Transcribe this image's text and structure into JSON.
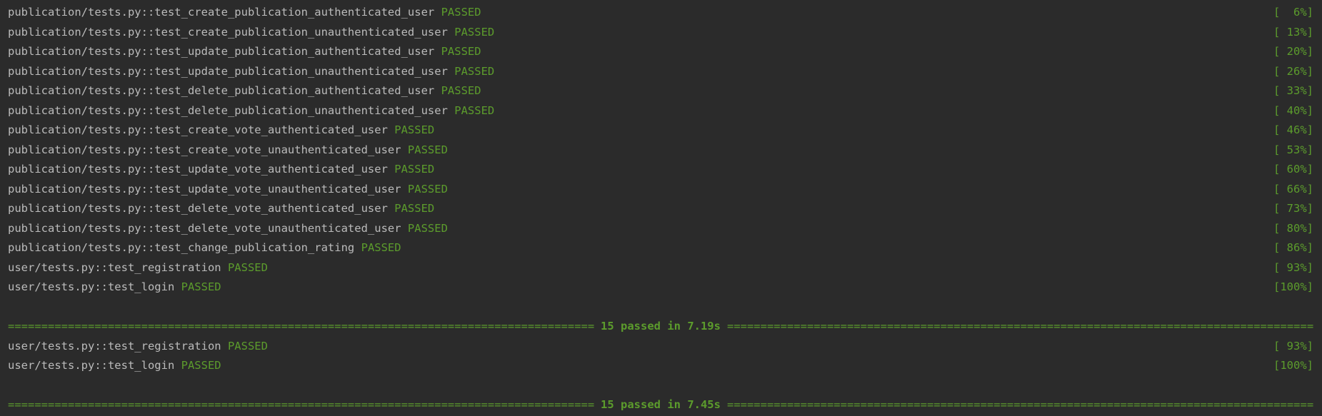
{
  "run1": {
    "lines": [
      {
        "test": "publication/tests.py::test_create_publication_authenticated_user",
        "status": "PASSED",
        "pct": "[  6%]"
      },
      {
        "test": "publication/tests.py::test_create_publication_unauthenticated_user",
        "status": "PASSED",
        "pct": "[ 13%]"
      },
      {
        "test": "publication/tests.py::test_update_publication_authenticated_user",
        "status": "PASSED",
        "pct": "[ 20%]"
      },
      {
        "test": "publication/tests.py::test_update_publication_unauthenticated_user",
        "status": "PASSED",
        "pct": "[ 26%]"
      },
      {
        "test": "publication/tests.py::test_delete_publication_authenticated_user",
        "status": "PASSED",
        "pct": "[ 33%]"
      },
      {
        "test": "publication/tests.py::test_delete_publication_unauthenticated_user",
        "status": "PASSED",
        "pct": "[ 40%]"
      },
      {
        "test": "publication/tests.py::test_create_vote_authenticated_user",
        "status": "PASSED",
        "pct": "[ 46%]"
      },
      {
        "test": "publication/tests.py::test_create_vote_unauthenticated_user",
        "status": "PASSED",
        "pct": "[ 53%]"
      },
      {
        "test": "publication/tests.py::test_update_vote_authenticated_user",
        "status": "PASSED",
        "pct": "[ 60%]"
      },
      {
        "test": "publication/tests.py::test_update_vote_unauthenticated_user",
        "status": "PASSED",
        "pct": "[ 66%]"
      },
      {
        "test": "publication/tests.py::test_delete_vote_authenticated_user",
        "status": "PASSED",
        "pct": "[ 73%]"
      },
      {
        "test": "publication/tests.py::test_delete_vote_unauthenticated_user",
        "status": "PASSED",
        "pct": "[ 80%]"
      },
      {
        "test": "publication/tests.py::test_change_publication_rating",
        "status": "PASSED",
        "pct": "[ 86%]"
      },
      {
        "test": "user/tests.py::test_registration",
        "status": "PASSED",
        "pct": "[ 93%]"
      },
      {
        "test": "user/tests.py::test_login",
        "status": "PASSED",
        "pct": "[100%]"
      }
    ],
    "summary": "15 passed in 7.19s"
  },
  "run2": {
    "lines": [
      {
        "test": "user/tests.py::test_registration",
        "status": "PASSED",
        "pct": "[ 93%]"
      },
      {
        "test": "user/tests.py::test_login",
        "status": "PASSED",
        "pct": "[100%]"
      }
    ],
    "summary": "15 passed in 7.45s"
  },
  "colors": {
    "background": "#2b2b2b",
    "text": "#bbbbbb",
    "passed": "#5c9c2c"
  }
}
